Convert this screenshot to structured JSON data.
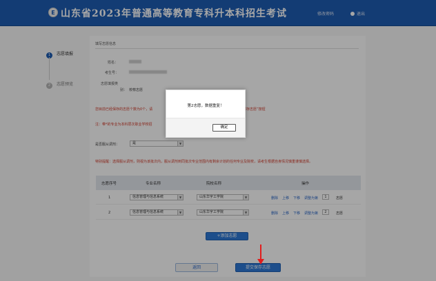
{
  "header": {
    "logo_text": "E",
    "title": "山东省2023年普通高等教育专科升本科招生考试",
    "change_password": "修改密码",
    "logout": "退出"
  },
  "steps": [
    {
      "num": "1",
      "label": "志愿填报"
    },
    {
      "num": "2",
      "label": "志愿预览"
    }
  ],
  "form": {
    "section_title": "填写志愿信息",
    "name_label": "姓名：",
    "exam_no_label": "考生号：",
    "category_label_line1": "志愿填报类",
    "category_label_line2": "别：",
    "category_value": "校荐志愿",
    "notice_1": "您目前已经保存的志愿个数为0个，请",
    "notice_1_tail": "保存志愿”按钮",
    "notice_2": "注：带*的专业为本科层次职业学校招",
    "obey_label": "是否服从调剂：",
    "obey_value": "是",
    "warning": "特别提醒：选择服从调剂，则视为该批次内，服从调剂到同批次专业范围内有剩余计划的任何专业及院校，请考生根据自身情况慎重谨慎选择。"
  },
  "table": {
    "headers": [
      "志愿序号",
      "专业名称",
      "院校名称",
      "操作"
    ],
    "rows": [
      {
        "index": "1",
        "major": "信息管理与信息系统",
        "school": "山东华宇工学院",
        "order": "1"
      },
      {
        "index": "2",
        "major": "信息管理与信息系统",
        "school": "山东华宇工学院",
        "order": "2"
      }
    ],
    "ops": {
      "delete": "删除",
      "up": "上移",
      "down": "下移",
      "adjust_prefix": "调整为第",
      "adjust_suffix": "志愿"
    }
  },
  "buttons": {
    "add": "+添加志愿",
    "back": "返回",
    "submit": "提交保存志愿"
  },
  "modal": {
    "message": "第2志愿，数据重复！",
    "ok": "确定"
  },
  "colors": {
    "header_bg": "#1e5cb3",
    "primary": "#2d79d6",
    "warning_text": "#d23b2b",
    "annotation_arrow": "#e21c1c"
  }
}
